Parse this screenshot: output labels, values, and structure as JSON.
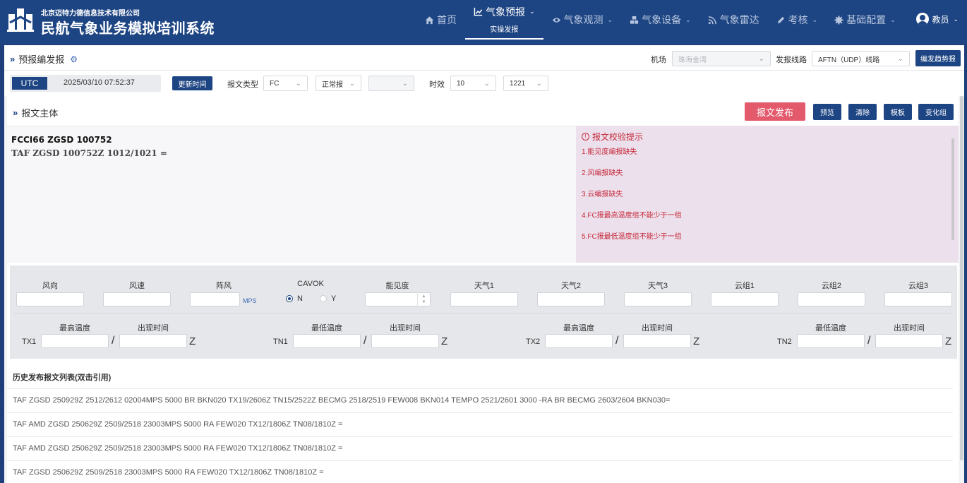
{
  "header": {
    "company": "北京迈特力德信息技术有限公司",
    "system_name": "民航气象业务模拟培训系统",
    "nav": [
      {
        "label": "首页",
        "icon": "home-icon",
        "sub": "",
        "dropdown": false,
        "active": false
      },
      {
        "label": "气象预报",
        "icon": "chart-line-icon",
        "sub": "实操发报",
        "dropdown": true,
        "active": true
      },
      {
        "label": "气象观测",
        "icon": "eye-icon",
        "sub": "",
        "dropdown": true,
        "active": false
      },
      {
        "label": "气象设备",
        "icon": "cubes-icon",
        "sub": "",
        "dropdown": true,
        "active": false
      },
      {
        "label": "气象雷达",
        "icon": "rss-icon",
        "sub": "",
        "dropdown": false,
        "active": false
      },
      {
        "label": "考核",
        "icon": "pen-icon",
        "sub": "",
        "dropdown": true,
        "active": false
      },
      {
        "label": "基础配置",
        "icon": "gear-icon",
        "sub": "",
        "dropdown": true,
        "active": false
      }
    ],
    "user": "教员",
    "brand_color": "#1e4583"
  },
  "toolbar": {
    "title": "预报编发报",
    "airport_label": "机场",
    "airport_value": "珠海金湾",
    "route_label": "发报线路",
    "route_value": "AFTN（UDP）线路",
    "trend_button": "编发趋势报"
  },
  "time_bar": {
    "utc_label": "UTC",
    "utc_time": "2025/03/10 07:52:37",
    "refresh_button": "更新时间",
    "type_label": "报文类型",
    "type_value": "FC",
    "kind_value": "正常报",
    "extra_value": "",
    "validity_label": "时效",
    "validity_value": "10",
    "period_value": "1221"
  },
  "body": {
    "title": "报文主体",
    "publish_button": "报文发布",
    "preview_button": "预览",
    "clear_button": "清除",
    "template_button": "模板",
    "change_group_button": "变化组",
    "publish_color": "#e35a6d",
    "message_line1": "FCCI66 ZGSD 100752",
    "message_line2": "TAF ZGSD 100752Z 1012/1021 =",
    "check": {
      "title": "报文校验提示",
      "items": [
        "1.能见度编报缺失",
        "2.风编报缺失",
        "3.云编报缺失",
        "4.FC报最高温度组不能少于一组",
        "5.FC报最低温度组不能少于一组"
      ],
      "color": "#c6293a"
    }
  },
  "form": {
    "wind_dir": "风向",
    "wind_speed": "风速",
    "gust": "阵风",
    "gust_unit": "MPS",
    "cavok": "CAVOK",
    "cavok_n": "N",
    "cavok_y": "Y",
    "visibility": "能见度",
    "weather1": "天气1",
    "weather2": "天气2",
    "weather3": "天气3",
    "cloud1": "云组1",
    "cloud2": "云组2",
    "cloud3": "云组3",
    "temps": [
      {
        "code": "TX1",
        "temp_label": "最高温度",
        "time_label": "出现时间"
      },
      {
        "code": "TN1",
        "temp_label": "最低温度",
        "time_label": "出现时间"
      },
      {
        "code": "TX2",
        "temp_label": "最高温度",
        "time_label": "出现时间"
      },
      {
        "code": "TN2",
        "temp_label": "最低温度",
        "time_label": "出现时间"
      }
    ],
    "slash": "/",
    "z": "Z"
  },
  "history": {
    "title": "历史发布报文列表(双击引用)",
    "rows": [
      "TAF ZGSD 250929Z 2512/2612 02004MPS 5000 BR BKN020 TX19/2606Z TN15/2522Z BECMG 2518/2519 FEW008 BKN014 TEMPO 2521/2601 3000 -RA BR BECMG 2603/2604 BKN030=",
      "TAF AMD ZGSD 250629Z 2509/2518 23003MPS 5000 RA FEW020 TX12/1806Z TN08/1810Z =",
      "TAF AMD ZGSD 250629Z 2509/2518 23003MPS 5000 RA FEW020 TX12/1806Z TN08/1810Z =",
      "TAF ZGSD 250629Z 2509/2518 23003MPS 5000 RA FEW020 TX12/1806Z TN08/1810Z ="
    ]
  }
}
